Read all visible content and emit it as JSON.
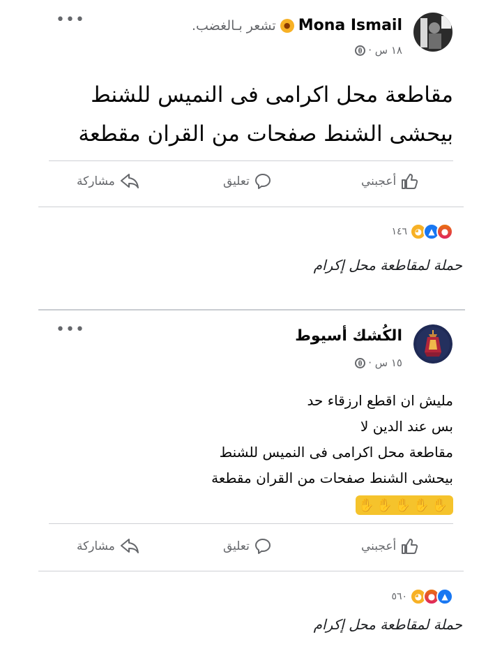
{
  "post1": {
    "author": "Mona Ismail",
    "feeling": "تشعر بـالغضب.",
    "time": "١٨ س ·",
    "lines": [
      "مقاطعة محل اكرامى فى النميس للشنط",
      "بيحشى الشنط صفحات من القران مقطعة"
    ],
    "actions": {
      "like": "أعجبني",
      "comment": "تعليق",
      "share": "مشاركة"
    },
    "reaction_count": "١٤٦",
    "caption": "حملة لمقاطعة محل إكرام"
  },
  "post2": {
    "author": "الكُشك أسيوط",
    "time": "١٥ س ·",
    "lines": [
      "مليش ان اقطع ارزقاء حد",
      "بس عند الدين لا",
      "مقاطعة محل اكرامى فى النميس للشنط",
      "بيحشى الشنط صفحات من القران مقطعة"
    ],
    "hands": "✋✋✋✋✋",
    "actions": {
      "like": "أعجبني",
      "comment": "تعليق",
      "share": "مشاركة"
    },
    "reaction_count": "٥٦٠",
    "caption": "حملة لمقاطعة محل إكرام"
  },
  "ui": {
    "more": "•••",
    "angry_emoji": "😠"
  }
}
